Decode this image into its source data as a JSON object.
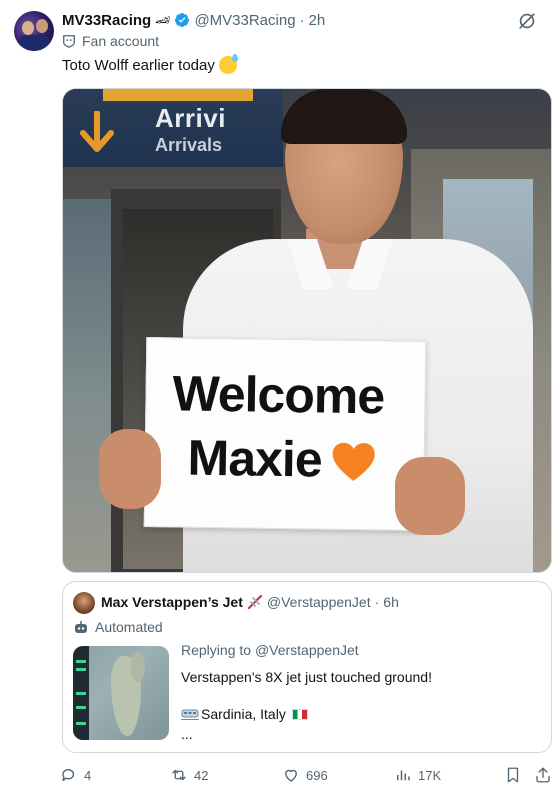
{
  "post": {
    "author_name": "MV33Racing",
    "author_handle": "@MV33Racing",
    "separator": "·",
    "time": "2h",
    "label": "Fan account",
    "text": "Toto Wolff earlier today",
    "image": {
      "sign_top": "Arrivi",
      "sign_bottom": "Arrivals",
      "card_line1": "Welcome",
      "card_line2": "Maxie"
    }
  },
  "quote": {
    "author_name": "Max Verstappen’s Jet",
    "author_handle": "@VerstappenJet",
    "separator": "·",
    "time": "6h",
    "label": "Automated",
    "replying_prefix": "Replying to ",
    "replying_handle": "@VerstappenJet",
    "text": "Verstappen's 8X jet just touched ground!",
    "location": "Sardinia, Italy",
    "ellipsis": "..."
  },
  "actions": {
    "replies": "4",
    "reposts": "42",
    "likes": "696",
    "views": "17K"
  },
  "colors": {
    "verified": "#1d9bf0",
    "secondary_text": "#536471",
    "border": "#cfd9de",
    "heart_orange": "#f58220"
  },
  "icons": [
    "verified-badge-icon",
    "grok-icon",
    "fan-badge-icon",
    "sweat-smile-emoji",
    "heart-emoji",
    "jet-icon",
    "bot-icon",
    "train-icon",
    "italy-flag-icon",
    "reply-icon",
    "repost-icon",
    "like-icon",
    "views-icon",
    "bookmark-icon",
    "share-icon"
  ]
}
